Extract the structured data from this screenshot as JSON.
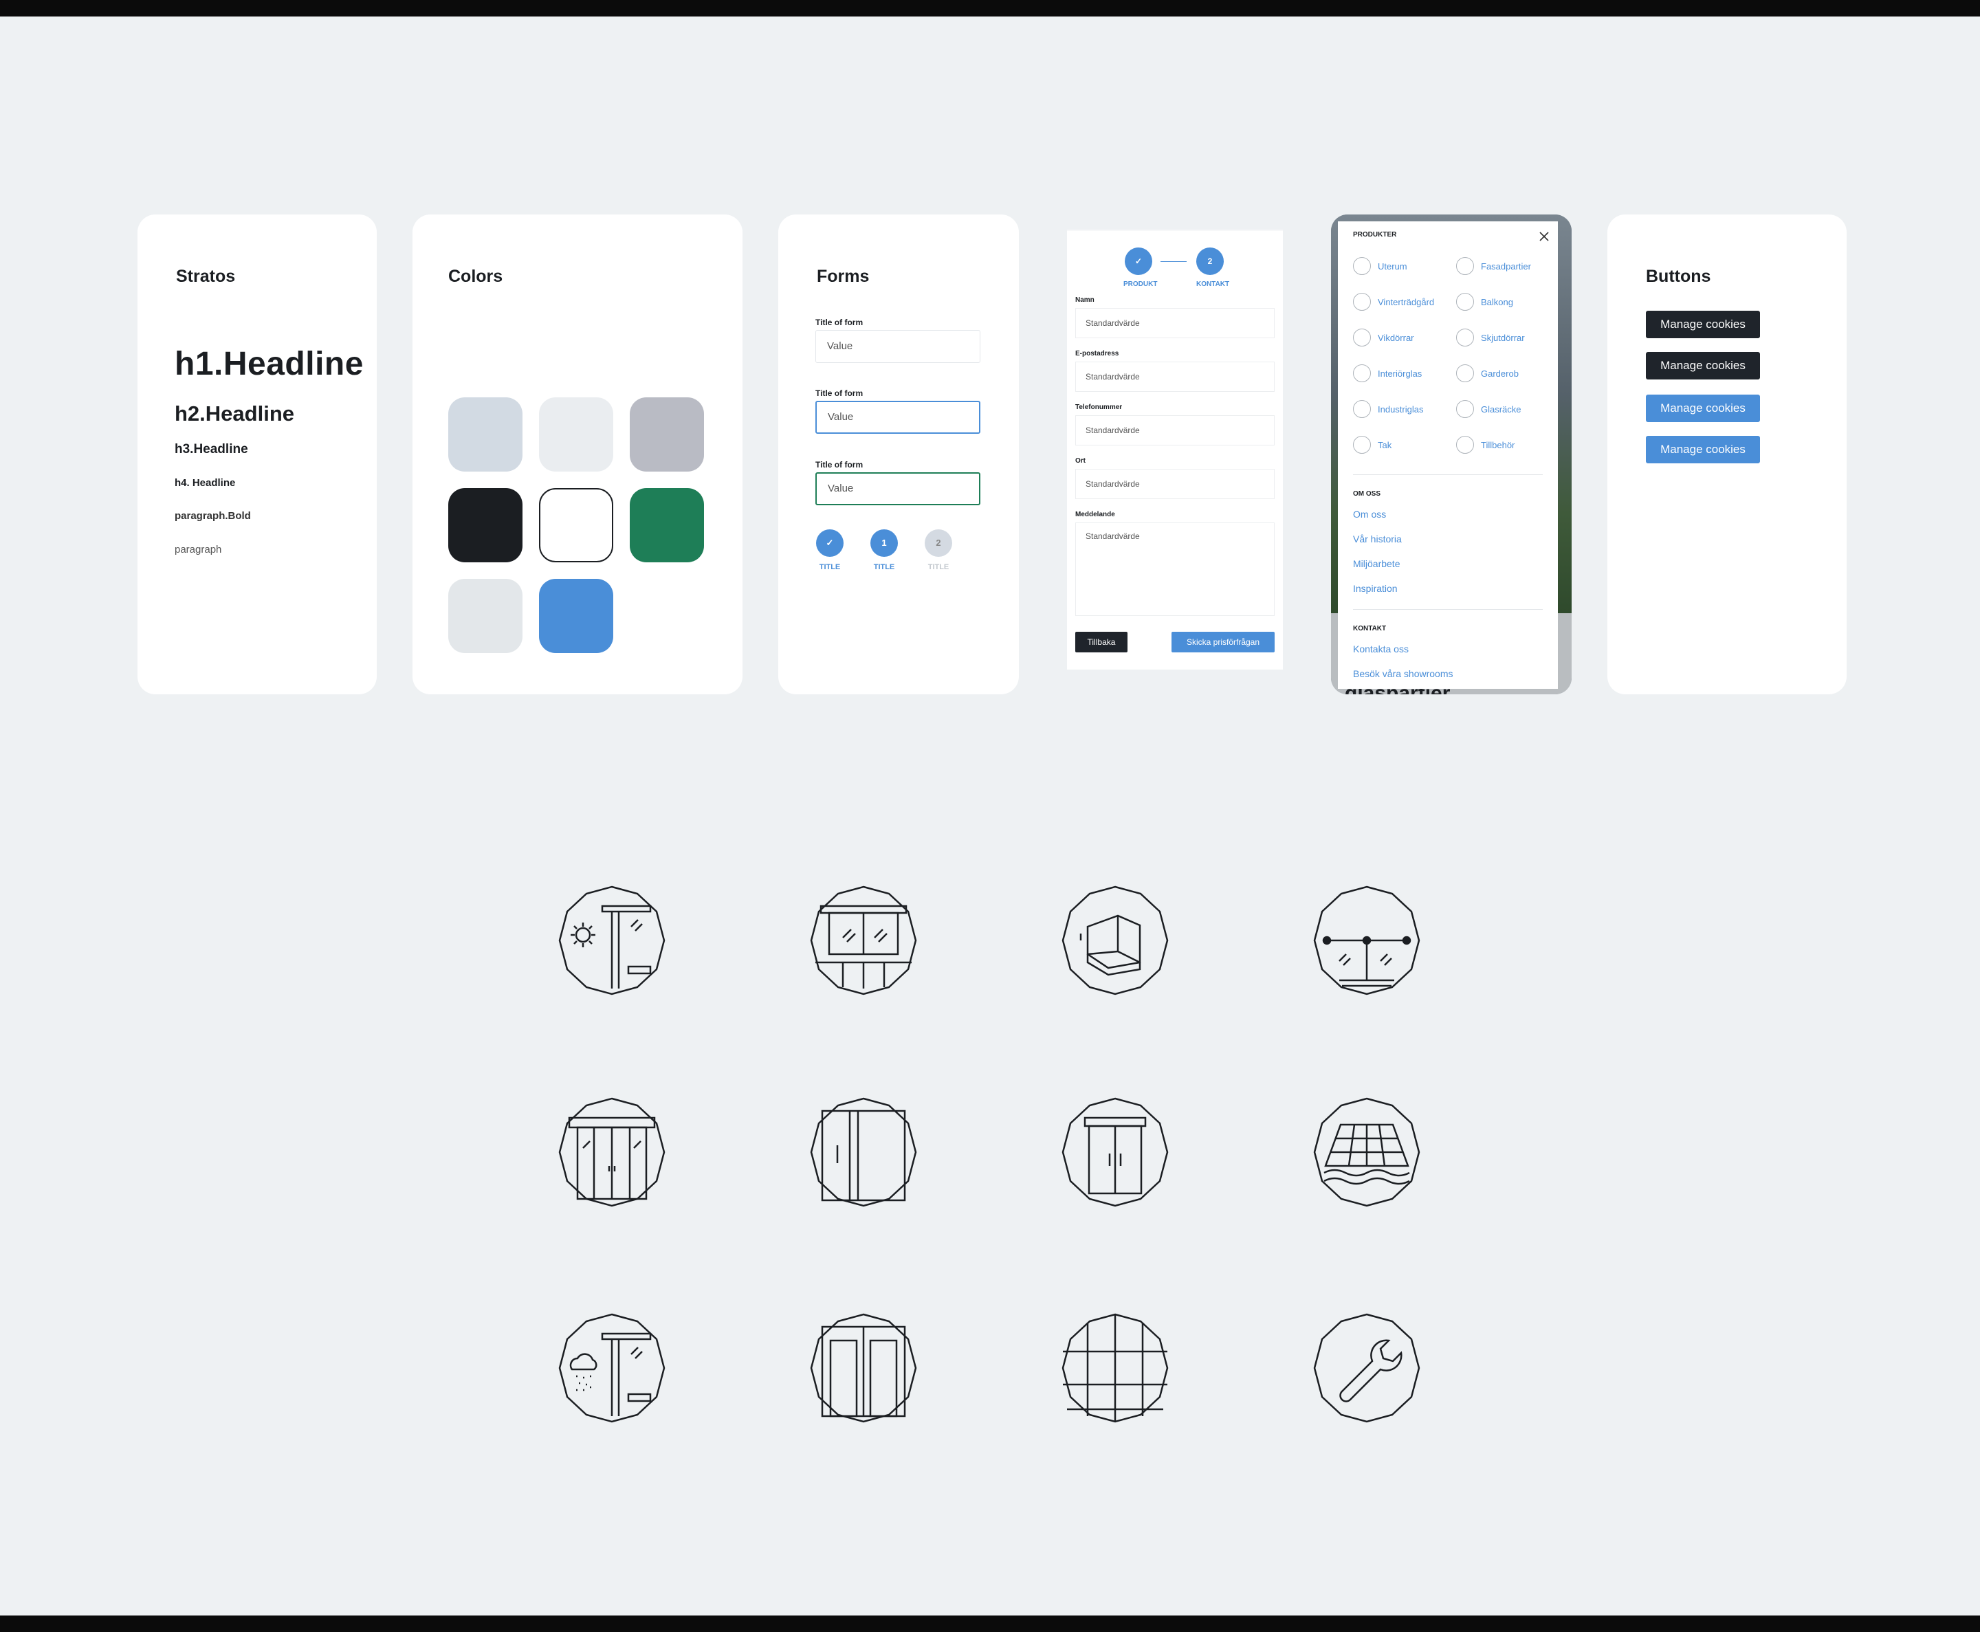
{
  "stratos": {
    "title": "Stratos",
    "h1": "h1.Headline",
    "h2": "h2.Headline",
    "h3": "h3.Headline",
    "h4": "h4. Headline",
    "paragraph_bold": "paragraph.Bold",
    "paragraph": "paragraph"
  },
  "colors": {
    "title": "Colors",
    "swatches": [
      "#d2dae3",
      "#eaedf0",
      "#b9bbc4",
      "#1b1e22",
      "#ffffff",
      "#1e7e57",
      "#e3e7ea",
      "#4a8ed8"
    ]
  },
  "forms": {
    "title": "Forms",
    "fields": [
      {
        "label": "Title of form",
        "value": "Value"
      },
      {
        "label": "Title of form",
        "value": "Value"
      },
      {
        "label": "Title of form",
        "value": "Value"
      }
    ],
    "steps": [
      {
        "num": "✓",
        "label": "TITLE"
      },
      {
        "num": "1",
        "label": "TITLE"
      },
      {
        "num": "2",
        "label": "TITLE"
      }
    ]
  },
  "contact_form": {
    "step1_label": "PRODUKT",
    "step2_num": "2",
    "step2_label": "KONTAKT",
    "fields": [
      {
        "label": "Namn",
        "placeholder": "Standardvärde"
      },
      {
        "label": "E-postadress",
        "placeholder": "Standardvärde"
      },
      {
        "label": "Telefonummer",
        "placeholder": "Standardvärde"
      },
      {
        "label": "Ort",
        "placeholder": "Standardvärde"
      },
      {
        "label": "Meddelande",
        "placeholder": "Standardvärde"
      }
    ],
    "back_label": "Tillbaka",
    "send_label": "Skicka prisförfrågan"
  },
  "menu": {
    "products_heading": "PRODUKTER",
    "products": [
      "Uterum",
      "Fasadpartier",
      "Vinterträdgård",
      "Balkong",
      "Vikdörrar",
      "Skjutdörrar",
      "Interiörglas",
      "Garderob",
      "Industriglas",
      "Glasräcke",
      "Tak",
      "Tillbehör"
    ],
    "about_heading": "OM OSS",
    "about_links": [
      "Om oss",
      "Vår historia",
      "Miljöarbete",
      "Inspiration"
    ],
    "contact_heading": "KONTAKT",
    "contact_links": [
      "Kontakta oss",
      "Besök våra showrooms"
    ],
    "bg_text": "glaspartier"
  },
  "buttons": {
    "title": "Buttons",
    "items": [
      "Manage cookies",
      "Manage cookies",
      "Manage cookies",
      "Manage cookies"
    ]
  }
}
